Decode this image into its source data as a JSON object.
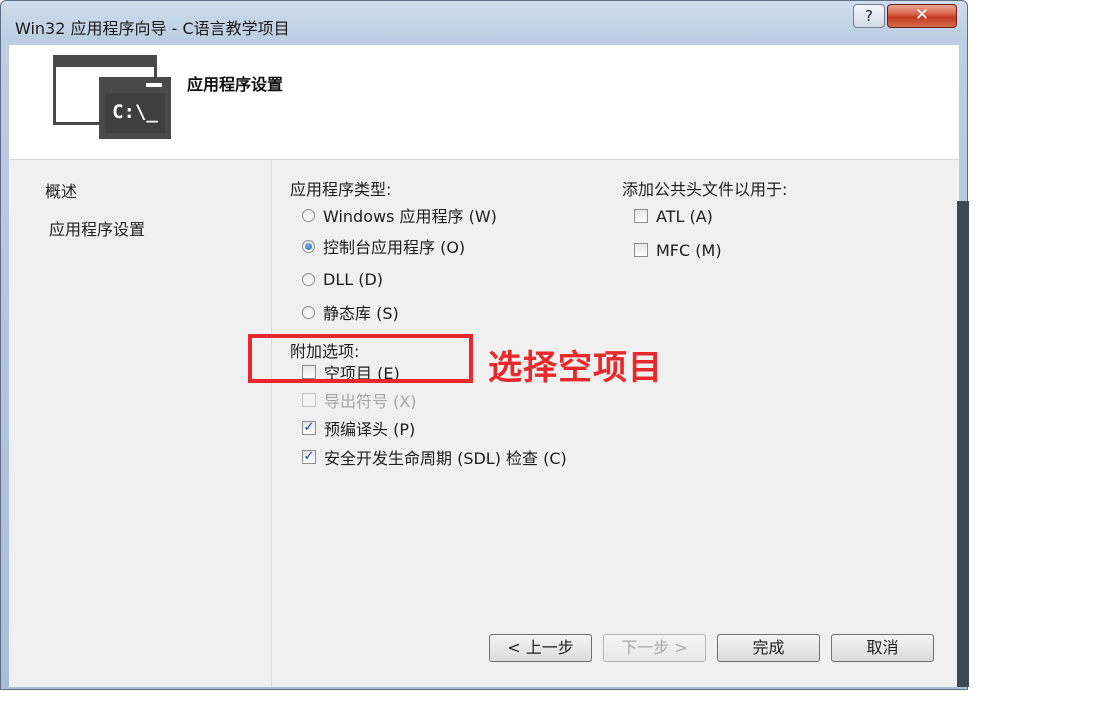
{
  "window": {
    "title": "Win32 应用程序向导 - C语言教学项目",
    "help_label": "?",
    "close_label": "✕"
  },
  "header": {
    "icon_text": "C:\\_",
    "title": "应用程序设置"
  },
  "nav": {
    "items": [
      {
        "label": "概述"
      },
      {
        "label": "应用程序设置"
      }
    ]
  },
  "app_type": {
    "label": "应用程序类型:",
    "options": [
      {
        "label": "Windows 应用程序 (W)",
        "selected": false
      },
      {
        "label": "控制台应用程序 (O)",
        "selected": true
      },
      {
        "label": "DLL (D)",
        "selected": false
      },
      {
        "label": "静态库 (S)",
        "selected": false
      }
    ]
  },
  "extra": {
    "label": "附加选项:",
    "options": [
      {
        "label": "空项目 (E)",
        "checked": false,
        "enabled": true
      },
      {
        "label": "导出符号 (X)",
        "checked": false,
        "enabled": false
      },
      {
        "label": "预编译头 (P)",
        "checked": true,
        "enabled": true
      },
      {
        "label": "安全开发生命周期 (SDL) 检查 (C)",
        "checked": true,
        "enabled": true
      }
    ]
  },
  "headers": {
    "label": "添加公共头文件以用于:",
    "options": [
      {
        "label": "ATL (A)",
        "checked": false
      },
      {
        "label": "MFC (M)",
        "checked": false
      }
    ]
  },
  "buttons": {
    "prev": "< 上一步",
    "next": "下一步 >",
    "finish": "完成",
    "cancel": "取消"
  },
  "annotation": {
    "text": "选择空项目",
    "color": "#e8282a"
  }
}
